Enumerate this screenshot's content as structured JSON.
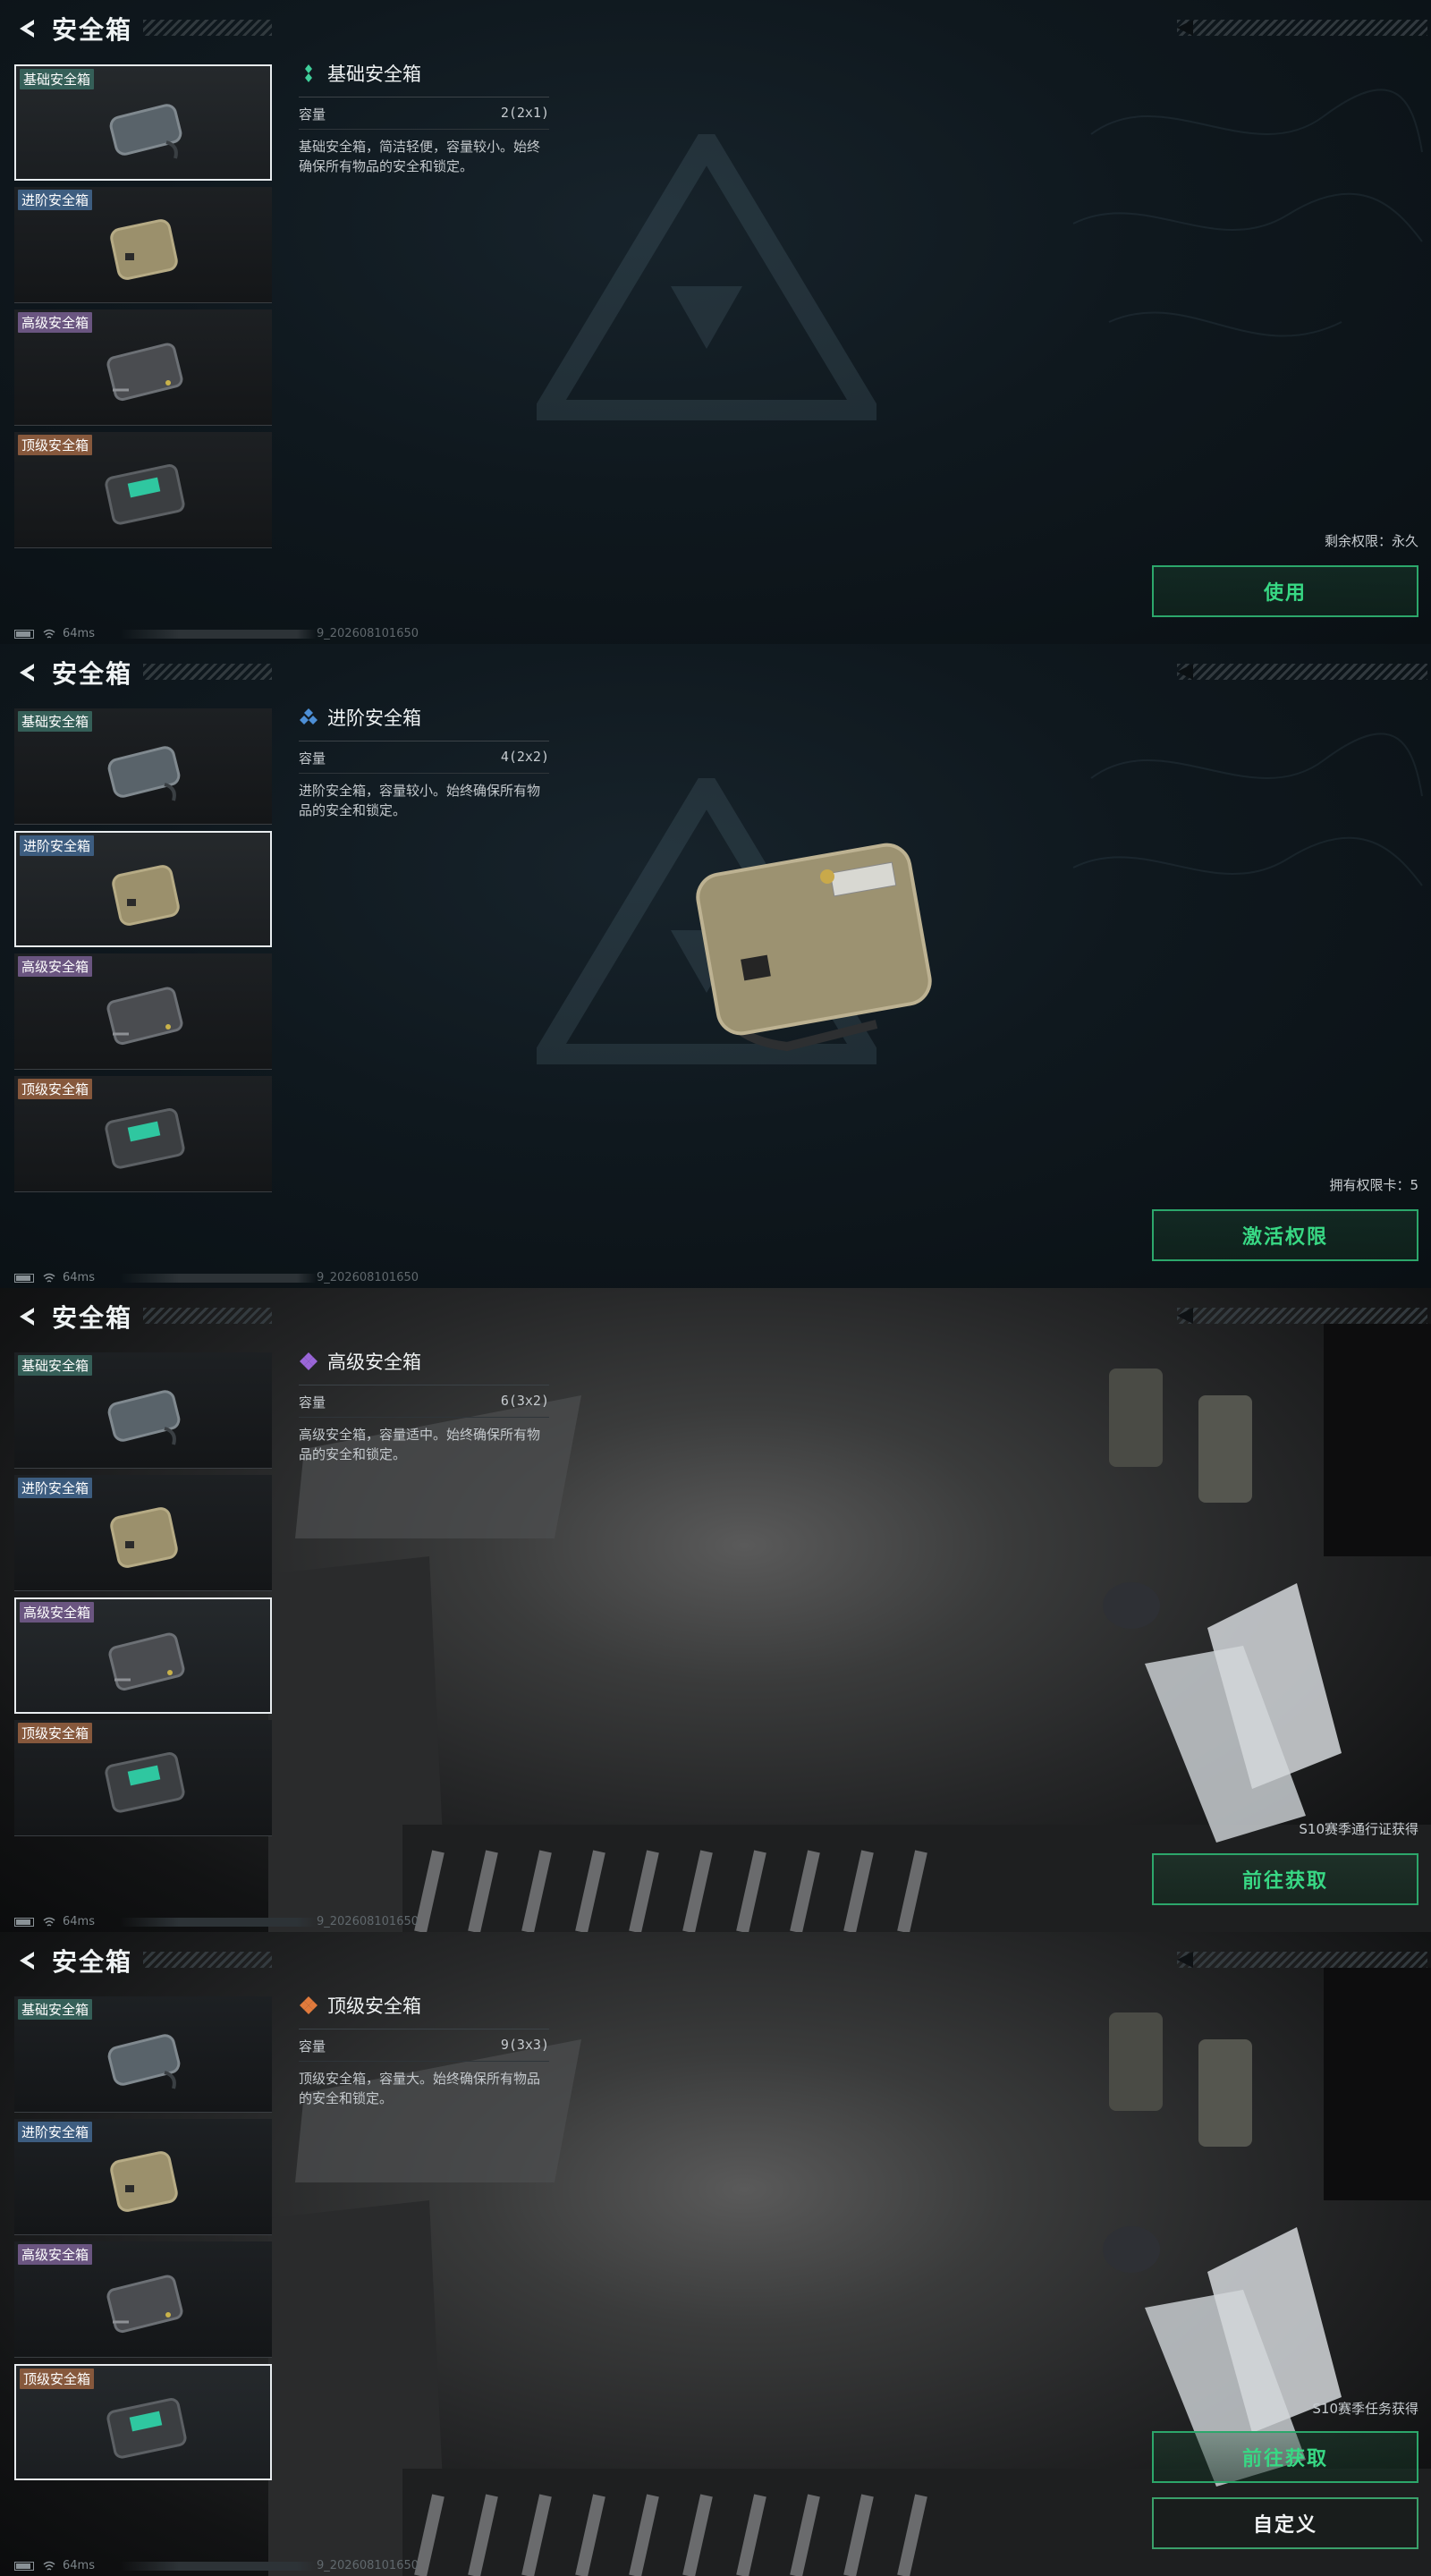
{
  "app": {
    "title": "安全箱",
    "back_icon": "back-arrow-icon"
  },
  "hud": {
    "ping": "64ms",
    "build": "9_202608101650",
    "icons": [
      "battery-icon",
      "wifi-icon"
    ]
  },
  "sidebar": {
    "items": [
      {
        "label": "基础安全箱",
        "color": "#355f58"
      },
      {
        "label": "进阶安全箱",
        "color": "#3d5d80"
      },
      {
        "label": "高级安全箱",
        "color": "#6a5580"
      },
      {
        "label": "顶级安全箱",
        "color": "#86583c"
      }
    ]
  },
  "panels": [
    {
      "selected_index": 0,
      "detail": {
        "name": "基础安全箱",
        "rarity_color": "#3fcf9a",
        "capacity_label": "容量",
        "capacity_value": "2(2x1)",
        "description": "基础安全箱，简洁轻便，容量较小。始终确保所有物品的安全和锁定。"
      },
      "status_text": "剩余权限：永久",
      "buttons": [
        {
          "label": "使用",
          "style": "primary"
        }
      ]
    },
    {
      "selected_index": 1,
      "detail": {
        "name": "进阶安全箱",
        "rarity_color": "#4d8fd6",
        "capacity_label": "容量",
        "capacity_value": "4(2x2)",
        "description": "进阶安全箱，容量较小。始终确保所有物品的安全和锁定。"
      },
      "status_text": "拥有权限卡：5",
      "buttons": [
        {
          "label": "激活权限",
          "style": "primary"
        }
      ]
    },
    {
      "selected_index": 2,
      "detail": {
        "name": "高级安全箱",
        "rarity_color": "#9a66d8",
        "capacity_label": "容量",
        "capacity_value": "6(3x2)",
        "description": "高级安全箱，容量适中。始终确保所有物品的安全和锁定。"
      },
      "status_text": "S10赛季通行证获得",
      "buttons": [
        {
          "label": "前往获取",
          "style": "primary"
        }
      ]
    },
    {
      "selected_index": 3,
      "detail": {
        "name": "顶级安全箱",
        "rarity_color": "#e07a3c",
        "capacity_label": "容量",
        "capacity_value": "9(3x3)",
        "description": "顶级安全箱，容量大。始终确保所有物品的安全和锁定。"
      },
      "status_text": "S10赛季任务获得",
      "buttons": [
        {
          "label": "前往获取",
          "style": "primary"
        },
        {
          "label": "自定义",
          "style": "neutral"
        }
      ]
    }
  ]
}
